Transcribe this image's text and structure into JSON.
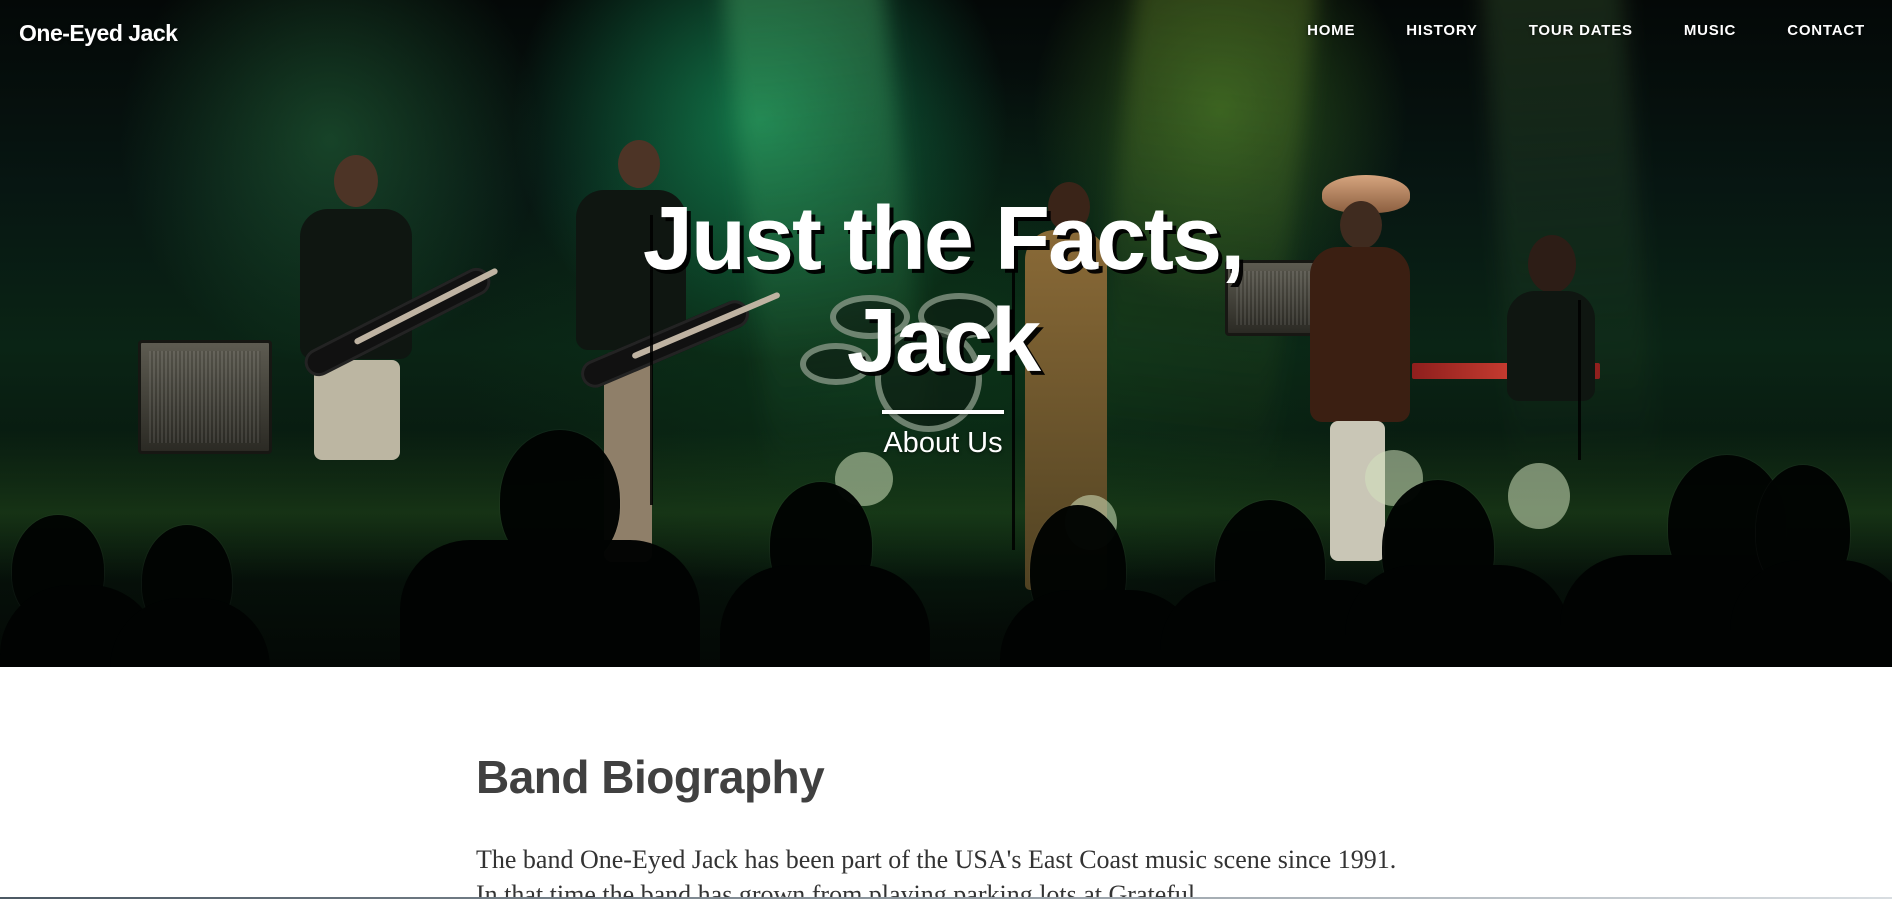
{
  "header": {
    "site_title": "One-Eyed Jack",
    "nav_items": [
      {
        "label": "HOME"
      },
      {
        "label": "HISTORY"
      },
      {
        "label": "TOUR DATES"
      },
      {
        "label": "MUSIC"
      },
      {
        "label": "CONTACT"
      }
    ]
  },
  "hero": {
    "title_line_1": "Just the Facts,",
    "title_line_2": "Jack",
    "subtitle": "About Us",
    "image_content": "live band performing on a green-lit stage with audience silhouettes"
  },
  "main": {
    "section_title": "Band Biography",
    "paragraph_visible": "The band One-Eyed Jack has been part of the USA's East Coast music scene since 1991. In that time the band has grown from playing parking lots at Grateful"
  },
  "colors": {
    "hero_green": "#16965c",
    "heading_gray": "#404040",
    "text_gray": "#333333",
    "white": "#ffffff"
  }
}
